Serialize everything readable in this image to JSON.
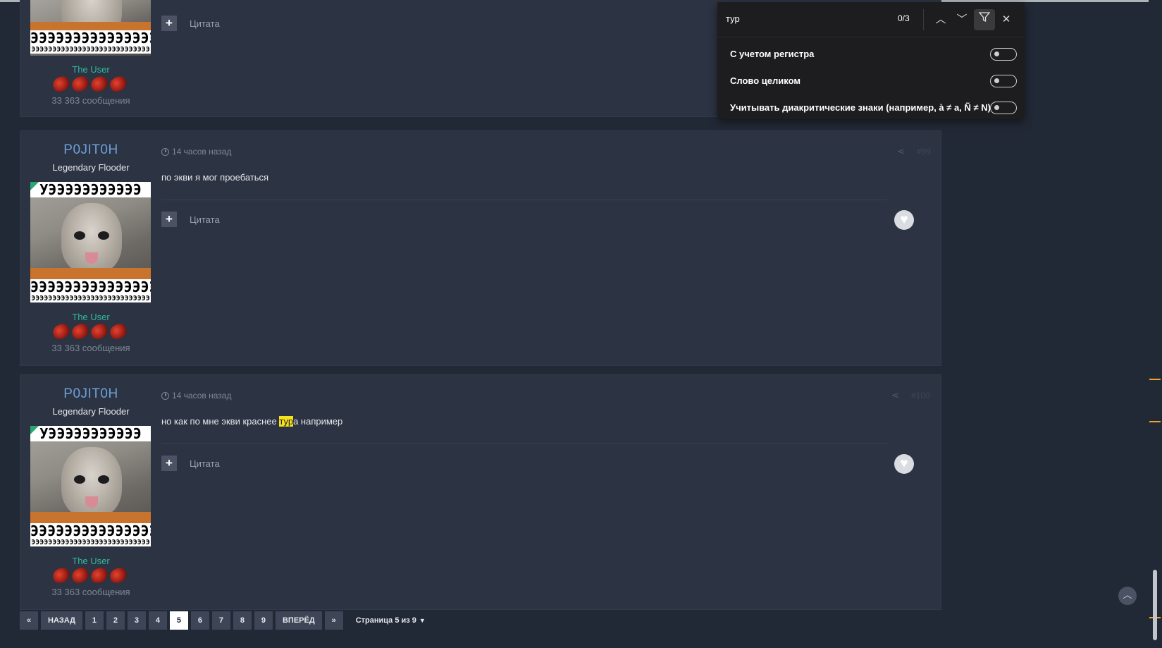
{
  "posts": [
    {
      "author": "",
      "rank": "",
      "group": "The User",
      "post_count": "33 363 сообщения",
      "quote_label": "Цитата"
    },
    {
      "author": "P0JIT0H",
      "rank": "Legendary Flooder",
      "timestamp": "14 часов назад",
      "post_number": "#99",
      "content": "по экви я мог проебаться",
      "group": "The User",
      "post_count": "33 363 сообщения",
      "quote_label": "Цитата"
    },
    {
      "author": "P0JIT0H",
      "rank": "Legendary Flooder",
      "timestamp": "14 часов назад",
      "post_number": "#100",
      "content_before": "но как по мне экви краснее ",
      "content_highlight": "тур",
      "content_after": "а например",
      "group": "The User",
      "post_count": "33 363 сообщения",
      "quote_label": "Цитата"
    }
  ],
  "avatar_text": {
    "top": "УЭЭЭЭЭЭЭЭЭЭЭ",
    "bottom": "ЭЭЭЭЭЭЭЭЭЭЭЭЭЭЭЭЭЭ",
    "bottom2": "ЭЭЭЭЭЭЭЭЭЭЭЭЭЭЭЭЭЭЭЭЭЭЭЭЭЭЭЭ"
  },
  "pagination": {
    "first": "«",
    "prev": "НАЗАД",
    "pages": [
      "1",
      "2",
      "3",
      "4",
      "5",
      "6",
      "7",
      "8",
      "9"
    ],
    "current": "5",
    "next": "ВПЕРЁД",
    "last": "»",
    "info": "Страница 5 из 9"
  },
  "find_bar": {
    "query": "тур",
    "count": "0/3",
    "options": [
      "С учетом регистра",
      "Слово целиком",
      "Учитывать диакритические знаки (например, à ≠ a, Ñ ≠ N)"
    ]
  },
  "icons": {
    "up": "chevron-up-icon",
    "down": "chevron-down-icon",
    "filter": "filter-icon",
    "close": "close-icon",
    "heart": "heart-icon",
    "share": "share-icon",
    "clock": "clock-icon"
  },
  "colors": {
    "page_bg": "#222936",
    "post_bg": "#2c3342",
    "author": "#6ea0d8",
    "group": "#30b89e",
    "highlight": "#f5e21d",
    "findbar_bg": "#1d1d1f",
    "scroll_mark": "#f0a12a"
  }
}
